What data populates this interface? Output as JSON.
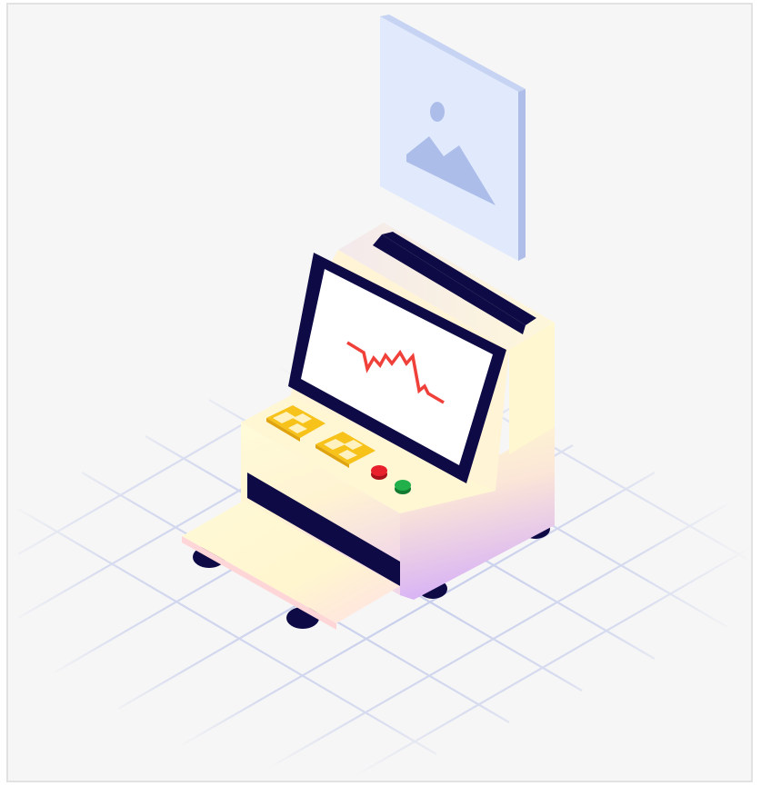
{
  "illustration": {
    "subject": "isometric-machine-with-monitor",
    "colors": {
      "background": "#f6f6f6",
      "frame_border": "#e2e2e2",
      "grid_line": "#c3cbe8",
      "dark": "#0d0a45",
      "screen_bg": "#ffffff",
      "waveform": "#f0403a",
      "button_red": "#e8202c",
      "button_green": "#22b04a",
      "checker_yellow": "#f7c21a",
      "checker_light": "#fff3c0",
      "body_light": "#fff9d8",
      "body_purple": "#d6b6f5",
      "image_card": "#dde7fb",
      "image_card_side": "#aebee8",
      "image_icon": "#aebee8"
    },
    "icons": [
      "image-placeholder-icon",
      "waveform-icon"
    ]
  }
}
